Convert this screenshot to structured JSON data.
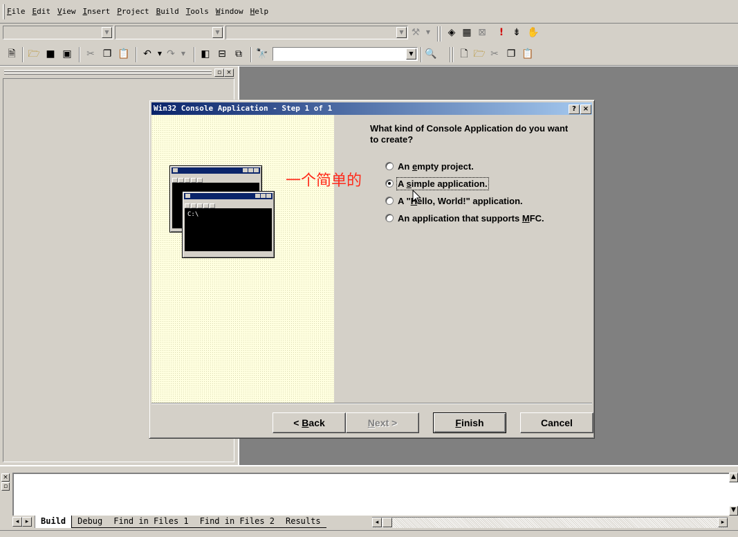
{
  "menu": {
    "items": [
      {
        "key": "F",
        "rest": "ile"
      },
      {
        "key": "E",
        "rest": "dit"
      },
      {
        "key": "V",
        "rest": "iew"
      },
      {
        "key": "I",
        "rest": "nsert"
      },
      {
        "key": "P",
        "rest": "roject"
      },
      {
        "key": "B",
        "rest": "uild"
      },
      {
        "key": "T",
        "rest": "ools"
      },
      {
        "key": "W",
        "rest": "indow"
      },
      {
        "key": "H",
        "rest": "elp"
      }
    ]
  },
  "toolbar": {
    "find_value": "",
    "icons": [
      "new-text-file-icon",
      "open-icon",
      "save-icon",
      "save-all-icon",
      "cut-icon",
      "copy-icon",
      "paste-icon",
      "undo-icon",
      "redo-icon",
      "workspace-icon",
      "output-icon",
      "window-list-icon",
      "find-in-files-icon",
      "find-icon",
      "new-icon",
      "open-icon",
      "cut-icon",
      "copy-icon",
      "paste-icon",
      "compile-icon",
      "build-icon",
      "stop-build-icon",
      "execute-icon",
      "insert-breakpoint-icon",
      "go-icon"
    ]
  },
  "dialog": {
    "title": "Win32 Console Application - Step 1 of 1",
    "help_button": "?",
    "close_button": "×",
    "question": "What kind of Console Application do you want to create?",
    "options": [
      {
        "pre": "An ",
        "key": "e",
        "post": "mpty project.",
        "selected": false
      },
      {
        "pre": "A ",
        "key": "s",
        "post": "imple application.",
        "selected": true
      },
      {
        "pre": "A \"",
        "key": "H",
        "post": "ello, World!\" application.",
        "selected": false
      },
      {
        "pre": "An application that supports ",
        "key": "M",
        "post": "FC.",
        "selected": false
      }
    ],
    "console_prompt": "C:\\",
    "buttons": {
      "back": {
        "pre": "< ",
        "key": "B",
        "post": "ack"
      },
      "next": {
        "pre": "",
        "key": "N",
        "post": "ext >"
      },
      "finish": {
        "pre": "",
        "key": "F",
        "post": "inish"
      },
      "cancel": "Cancel"
    }
  },
  "annotation": "一个简单的",
  "output": {
    "tabs": [
      "Build",
      "Debug",
      "Find in Files 1",
      "Find in Files 2",
      "Results"
    ]
  }
}
